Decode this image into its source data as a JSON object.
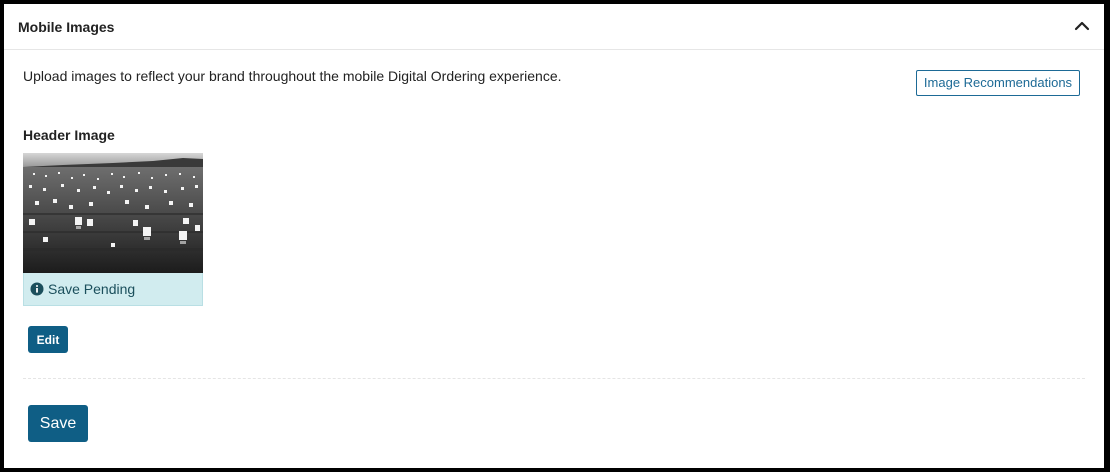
{
  "panel": {
    "title": "Mobile Images",
    "collapse_icon": "chevron-up-icon"
  },
  "main": {
    "description": "Upload images to reflect your brand throughout the mobile Digital Ordering experience.",
    "recommendations_label": "Image Recommendations",
    "header_image": {
      "label": "Header Image",
      "status_icon": "info-icon",
      "status": "Save Pending",
      "edit_label": "Edit"
    },
    "save_label": "Save"
  },
  "colors": {
    "accent": "#0f5e85",
    "pending_bg": "#d1ecef",
    "pending_text": "#1b4f5c"
  }
}
